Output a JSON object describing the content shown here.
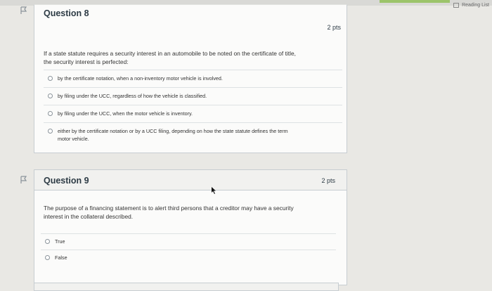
{
  "browser": {
    "reading_list_label": "Reading List"
  },
  "questions": [
    {
      "title": "Question 8",
      "points": "2 pts",
      "text_line1": "If a state statute requires a security interest in an automobile to be noted on the certificate of title,",
      "text_line2": "the security interest is perfected:",
      "answers": [
        {
          "line1": "by the certificate notation, when a non-inventory motor vehicle is involved.",
          "line2": ""
        },
        {
          "line1": "by filing under the UCC, regardless of how the vehicle is classified.",
          "line2": ""
        },
        {
          "line1": "by filing under the UCC, when the motor vehicle is inventory.",
          "line2": ""
        },
        {
          "line1": "either by the certificate notation or by a UCC filing, depending on how the state statute defines the term",
          "line2": "motor vehicle."
        }
      ]
    },
    {
      "title": "Question 9",
      "points": "2 pts",
      "text_line1": "The purpose of a financing statement is to alert third persons that a creditor may have a security",
      "text_line2": "interest in the collateral described.",
      "answers": [
        {
          "line1": "True",
          "line2": ""
        },
        {
          "line1": "False",
          "line2": ""
        }
      ]
    }
  ],
  "icons": {
    "flag": "flag-icon",
    "cursor": "mouse-cursor-icon",
    "reading_list": "reading-list-icon"
  },
  "colors": {
    "background": "#e9e8e4",
    "card": "#fbfbfa",
    "border": "#c7cdd1",
    "text": "#2d3b45"
  }
}
